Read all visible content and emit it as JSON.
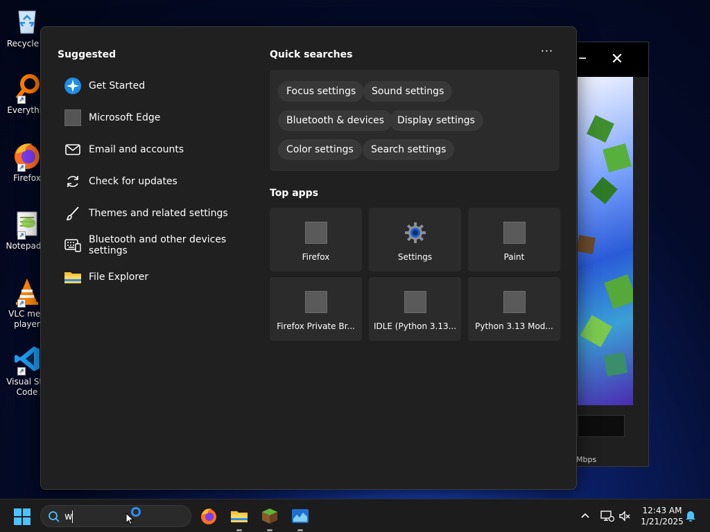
{
  "desktop": {
    "icons": [
      {
        "label": "Recycle B",
        "icon": "recycle-bin-icon"
      },
      {
        "label": "Everythin",
        "icon": "everything-search-icon"
      },
      {
        "label": "Firefox",
        "icon": "firefox-icon"
      },
      {
        "label": "Notepad+",
        "icon": "notepad-plus-plus-icon"
      },
      {
        "label": "VLC med player",
        "icon": "vlc-icon"
      },
      {
        "label": "Visual Stu Code",
        "icon": "vscode-icon"
      }
    ]
  },
  "background_window": {
    "speed_label": "Mbps"
  },
  "search_panel": {
    "suggested": {
      "title": "Suggested",
      "items": [
        {
          "label": "Get Started",
          "icon": "get-started-icon"
        },
        {
          "label": "Microsoft Edge",
          "icon": "edge-placeholder-icon"
        },
        {
          "label": "Email and accounts",
          "icon": "envelope-icon"
        },
        {
          "label": "Check for updates",
          "icon": "refresh-icon"
        },
        {
          "label": "Themes and related settings",
          "icon": "brush-icon"
        },
        {
          "label": "Bluetooth and other devices settings",
          "icon": "keyboard-device-icon"
        },
        {
          "label": "File Explorer",
          "icon": "folder-icon"
        }
      ]
    },
    "quick_searches": {
      "title": "Quick searches",
      "more_label": "···",
      "chips": [
        "Focus settings",
        "Sound settings",
        "Bluetooth & devices",
        "Display settings",
        "Color settings",
        "Search settings"
      ]
    },
    "top_apps": {
      "title": "Top apps",
      "apps": [
        {
          "label": "Firefox",
          "icon": "app-placeholder-icon"
        },
        {
          "label": "Settings",
          "icon": "settings-gear-icon"
        },
        {
          "label": "Paint",
          "icon": "app-placeholder-icon"
        },
        {
          "label": "Firefox Private Br...",
          "icon": "app-placeholder-icon"
        },
        {
          "label": "IDLE (Python 3.13...",
          "icon": "app-placeholder-icon"
        },
        {
          "label": "Python 3.13 Mod...",
          "icon": "app-placeholder-icon"
        }
      ]
    }
  },
  "taskbar": {
    "search_value": "w",
    "clock_time": "12:43 AM",
    "clock_date": "1/21/2025",
    "accent": "#4cc2ff"
  }
}
